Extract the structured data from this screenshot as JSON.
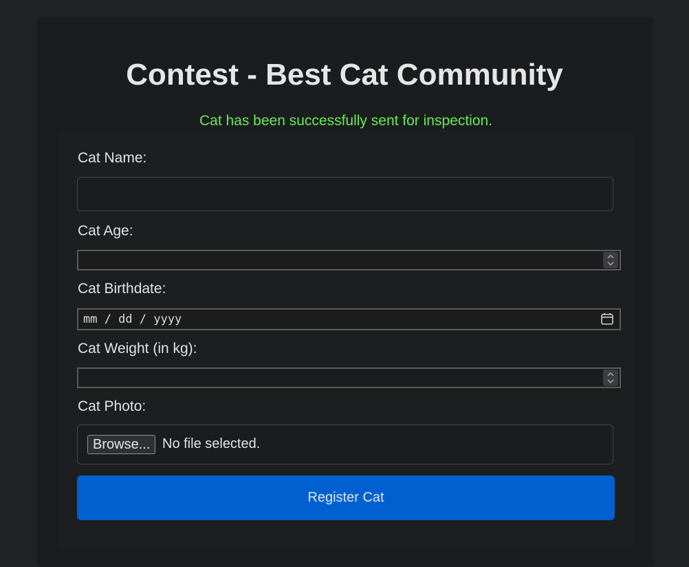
{
  "page": {
    "title": "Contest - Best Cat Community",
    "success_message": "Cat has been successfully sent for inspection."
  },
  "form": {
    "name_label": "Cat Name:",
    "name_value": "",
    "age_label": "Cat Age:",
    "age_value": "",
    "birthdate_label": "Cat Birthdate:",
    "birthdate_placeholder": "mm / dd / yyyy",
    "weight_label": "Cat Weight (in kg):",
    "weight_value": "",
    "photo_label": "Cat Photo:",
    "browse_label": "Browse...",
    "no_file_text": "No file selected.",
    "submit_label": "Register Cat"
  },
  "icons": {
    "age_spinner": "spinner-icon",
    "weight_spinner": "spinner-icon",
    "birthdate_picker": "calendar-icon"
  },
  "colors": {
    "background": "#1f2224",
    "panel": "#1a1c1e",
    "success": "#66ec57",
    "button": "#0060d0"
  }
}
